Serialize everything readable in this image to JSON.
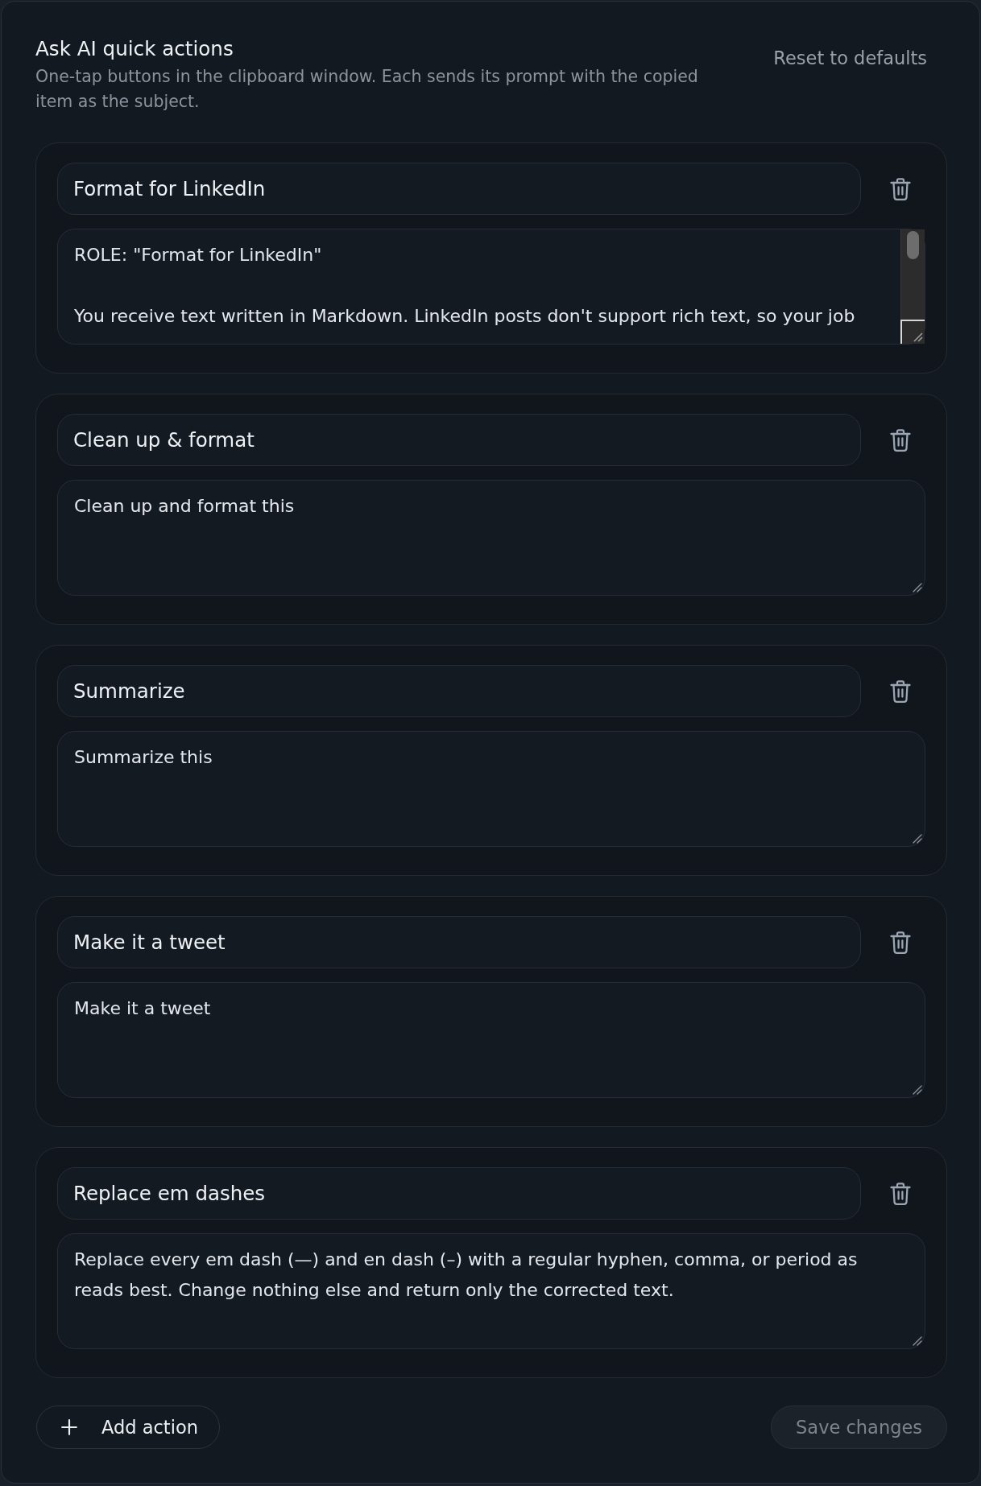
{
  "panel": {
    "title": "Ask AI quick actions",
    "description": "One-tap buttons in the clipboard window. Each sends its prompt with the copied item as the subject.",
    "reset_button": "Reset to defaults"
  },
  "actions": [
    {
      "name": "Format for LinkedIn",
      "prompt": "ROLE: \"Format for LinkedIn\"\n\nYou receive text written in Markdown. LinkedIn posts don't support rich text, so your job",
      "scrollable": true
    },
    {
      "name": "Clean up & format",
      "prompt": "Clean up and format this",
      "scrollable": false
    },
    {
      "name": "Summarize",
      "prompt": "Summarize this",
      "scrollable": false
    },
    {
      "name": "Make it a tweet",
      "prompt": "Make it a tweet",
      "scrollable": false
    },
    {
      "name": "Replace em dashes",
      "prompt": "Replace every em dash (—) and en dash (–) with a regular hyphen, comma, or period as reads best. Change nothing else and return only the corrected text.",
      "scrollable": false
    }
  ],
  "footer": {
    "add_button": "Add action",
    "save_button": {
      "label": "Save changes",
      "disabled": true
    }
  }
}
